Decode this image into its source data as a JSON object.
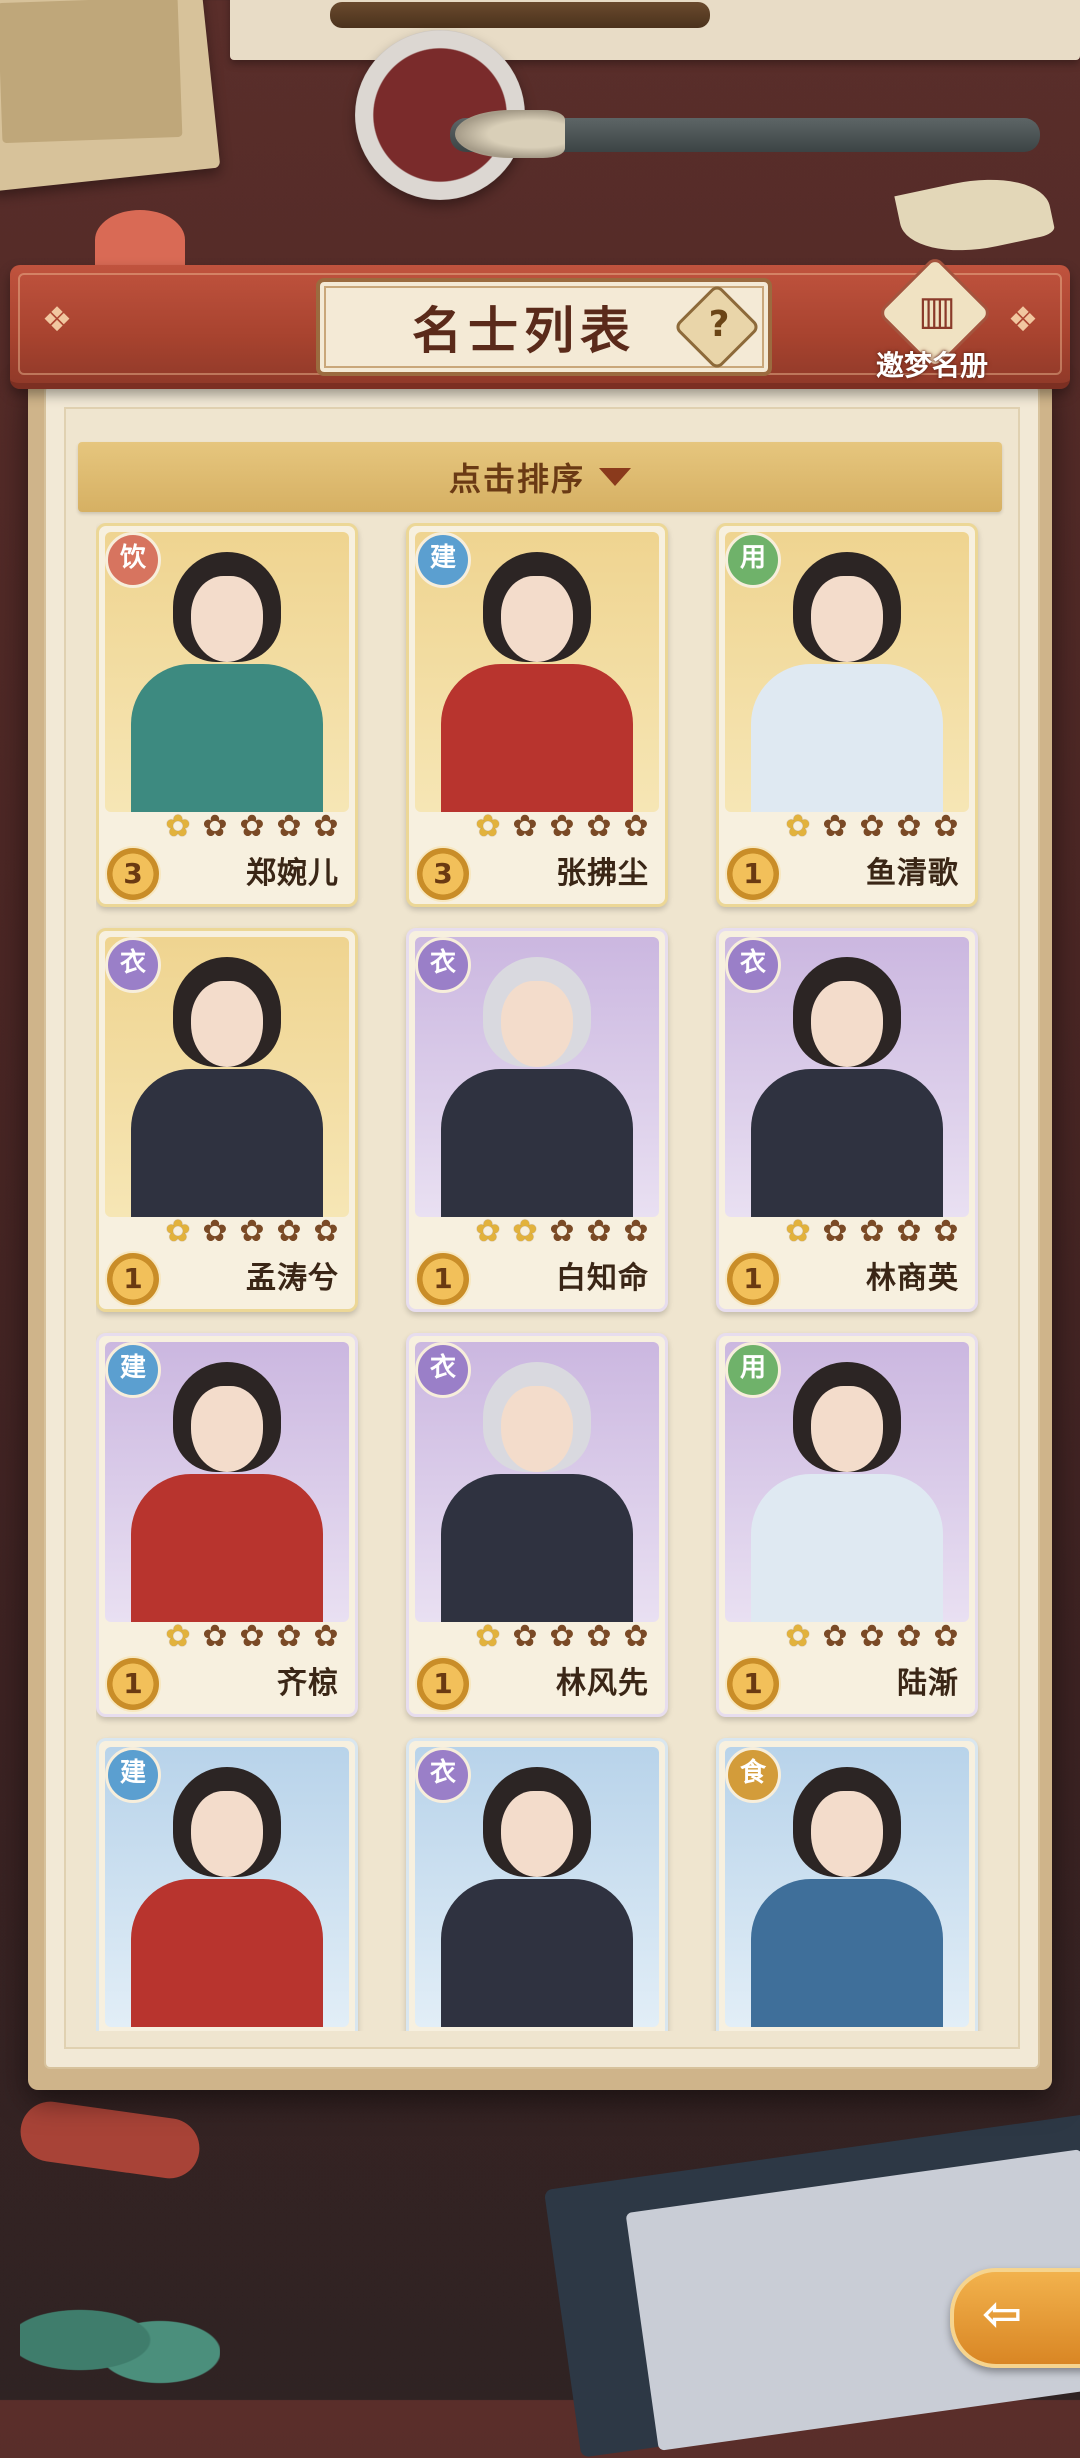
{
  "header": {
    "title": "名士列表",
    "help_label": "?",
    "dream_book_label": "邀梦名册"
  },
  "sort": {
    "label": "点击排序"
  },
  "cards": [
    {
      "tag": "饮",
      "tag_type": "yin",
      "bg": "gold",
      "level": "3",
      "name": "郑婉儿",
      "stars_filled": 1,
      "stars_total": 5
    },
    {
      "tag": "建",
      "tag_type": "jian",
      "bg": "gold",
      "level": "3",
      "name": "张拂尘",
      "stars_filled": 1,
      "stars_total": 5
    },
    {
      "tag": "用",
      "tag_type": "yong",
      "bg": "gold",
      "level": "1",
      "name": "鱼清歌",
      "stars_filled": 1,
      "stars_total": 5
    },
    {
      "tag": "衣",
      "tag_type": "yi",
      "bg": "gold",
      "level": "1",
      "name": "孟涛兮",
      "stars_filled": 1,
      "stars_total": 5
    },
    {
      "tag": "衣",
      "tag_type": "yi",
      "bg": "purple",
      "level": "1",
      "name": "白知命",
      "stars_filled": 2,
      "stars_total": 5
    },
    {
      "tag": "衣",
      "tag_type": "yi",
      "bg": "purple",
      "level": "1",
      "name": "林商英",
      "stars_filled": 1,
      "stars_total": 5
    },
    {
      "tag": "建",
      "tag_type": "jian",
      "bg": "purple",
      "level": "1",
      "name": "齐椋",
      "stars_filled": 1,
      "stars_total": 5
    },
    {
      "tag": "衣",
      "tag_type": "yi",
      "bg": "purple",
      "level": "1",
      "name": "林风先",
      "stars_filled": 1,
      "stars_total": 5
    },
    {
      "tag": "用",
      "tag_type": "yong",
      "bg": "purple",
      "level": "1",
      "name": "陆渐",
      "stars_filled": 1,
      "stars_total": 5
    },
    {
      "tag": "建",
      "tag_type": "jian",
      "bg": "blue",
      "level": "",
      "name": "",
      "stars_filled": 0,
      "stars_total": 0
    },
    {
      "tag": "衣",
      "tag_type": "yi",
      "bg": "blue",
      "level": "",
      "name": "",
      "stars_filled": 0,
      "stars_total": 0
    },
    {
      "tag": "食",
      "tag_type": "shi",
      "bg": "blue",
      "level": "",
      "name": "",
      "stars_filled": 0,
      "stars_total": 0
    }
  ],
  "colors": {
    "header_red": "#a8432f",
    "sort_bar_gold": "#d6b063",
    "title_brown": "#5a2a1a"
  },
  "icons": {
    "back": "back-arrow-icon",
    "dream_book": "book-icon",
    "star": "flower-star-icon"
  }
}
